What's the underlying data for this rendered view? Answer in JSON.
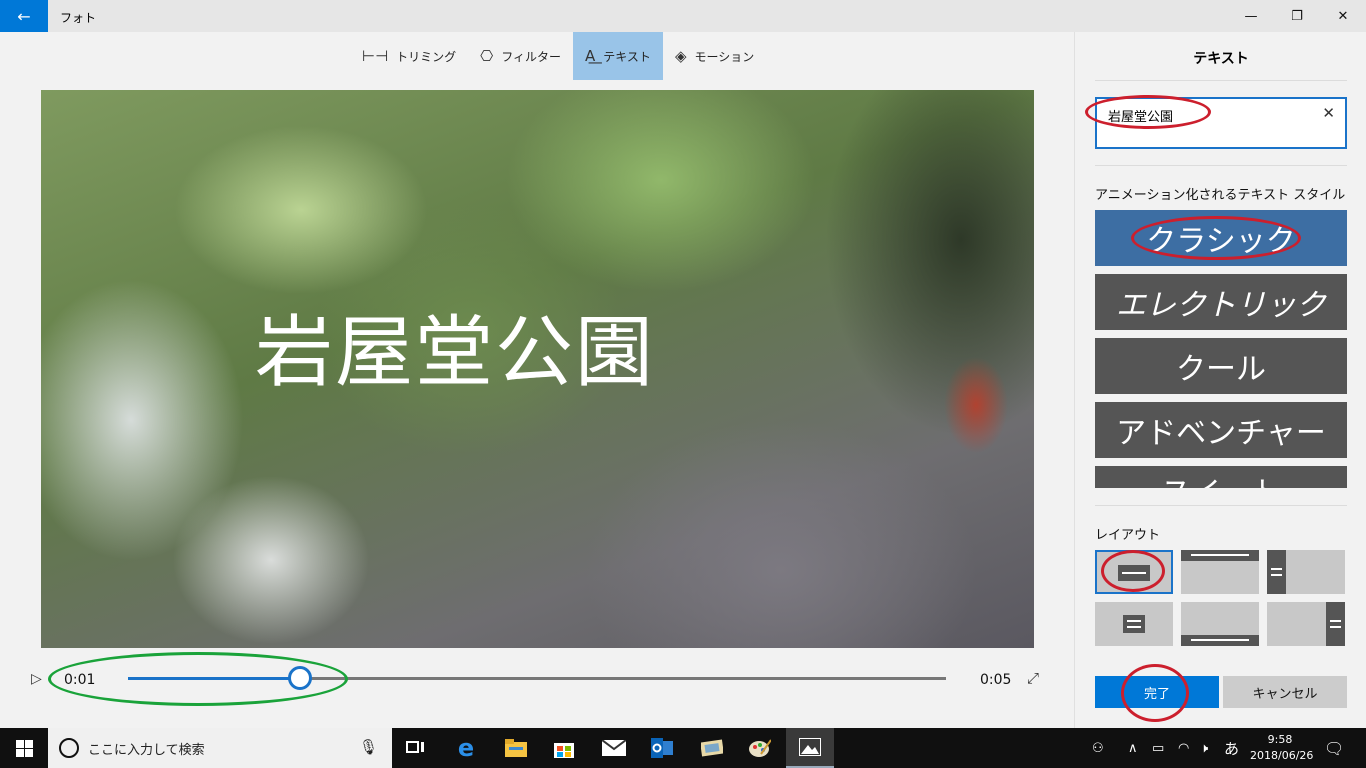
{
  "window": {
    "title": "フォト",
    "minimize_glyph": "—",
    "maximize_glyph": "❐",
    "close_glyph": "✕",
    "back_glyph": "←"
  },
  "toolbar": {
    "tabs": [
      {
        "icon": "trim-icon",
        "glyph": "⊢⊣",
        "label": "トリミング",
        "active": false
      },
      {
        "icon": "filter-icon",
        "glyph": "⎔",
        "label": "フィルター",
        "active": false
      },
      {
        "icon": "text-icon",
        "glyph": "A͟",
        "label": "テキスト",
        "active": true
      },
      {
        "icon": "motion-icon",
        "glyph": "◈",
        "label": "モーション",
        "active": false
      }
    ]
  },
  "preview": {
    "overlay_text": "岩屋堂公園"
  },
  "timeline": {
    "play_glyph": "▷",
    "current_time": "0:01",
    "end_time": "0:05",
    "position_fraction": 0.21,
    "fullscreen_glyph": "⤢"
  },
  "panel": {
    "title": "テキスト",
    "text_input_value": "岩屋堂公園",
    "clear_glyph": "✕",
    "styles_label": "アニメーション化されるテキスト スタイル",
    "styles": [
      {
        "label": "クラシック",
        "selected": true
      },
      {
        "label": "エレクトリック",
        "selected": false
      },
      {
        "label": "クール",
        "selected": false
      },
      {
        "label": "アドベンチャー",
        "selected": false
      },
      {
        "label": "スイート",
        "selected": false
      }
    ],
    "layout_label": "レイアウト",
    "done_label": "完了",
    "cancel_label": "キャンセル"
  },
  "taskbar": {
    "search_placeholder": "ここに入力して検索",
    "ime_glyph": "あ",
    "clock_time": "9:58",
    "clock_date": "2018/06/26"
  },
  "colors": {
    "accent": "#0078d7",
    "selected_style": "#3d6ea3",
    "annotation_red": "#cc1f2d",
    "annotation_green": "#1aa33a"
  }
}
